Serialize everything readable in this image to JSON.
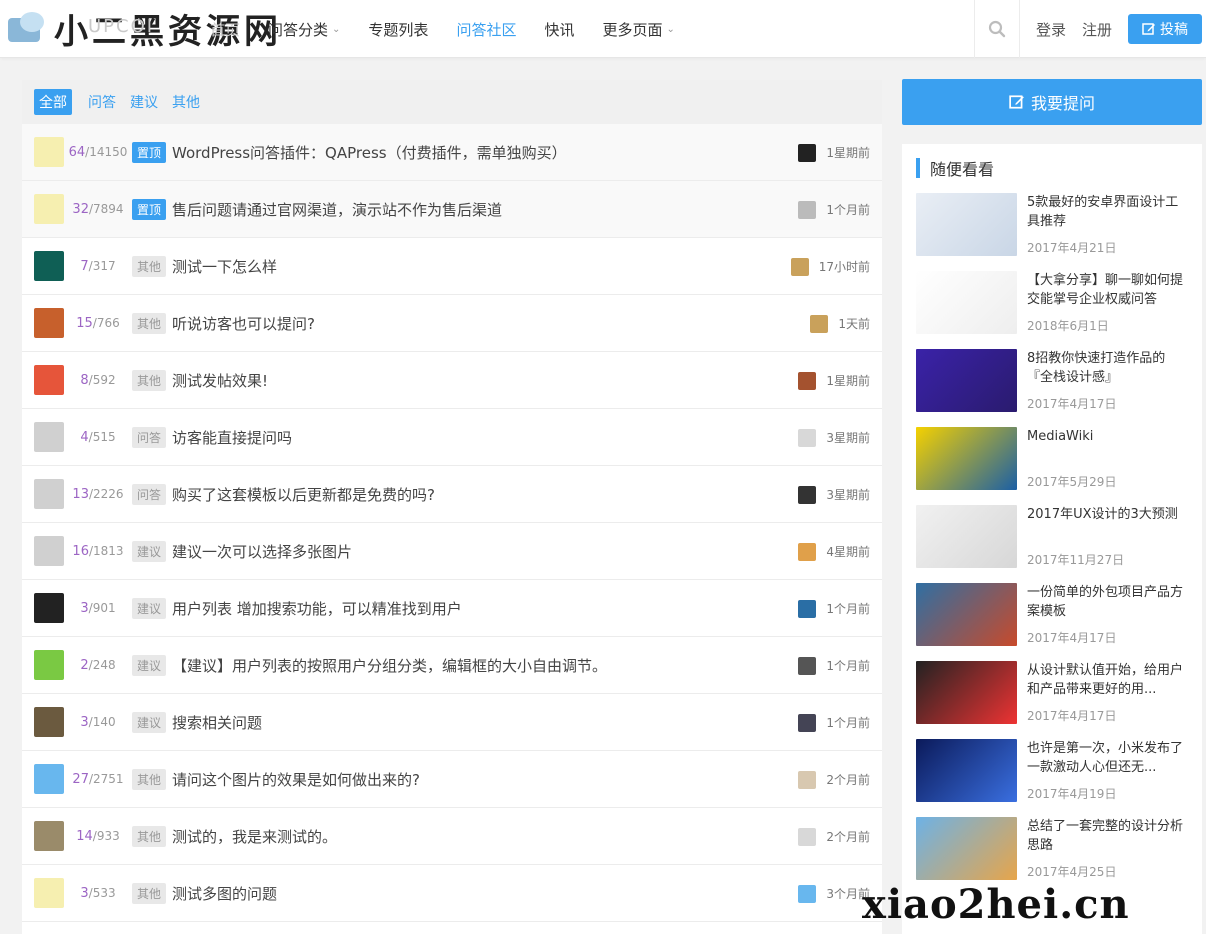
{
  "header": {
    "logo_text": "小二黑资源网",
    "logo_ghost": "UPCOI",
    "nav": [
      {
        "label": "首页",
        "dropdown": false
      },
      {
        "label": "问答分类",
        "dropdown": true
      },
      {
        "label": "专题列表",
        "dropdown": false
      },
      {
        "label": "问答社区",
        "dropdown": false,
        "active": true
      },
      {
        "label": "快讯",
        "dropdown": false
      },
      {
        "label": "更多页面",
        "dropdown": true
      }
    ],
    "login": "登录",
    "register": "注册",
    "submit": "投稿"
  },
  "filters": [
    "全部",
    "问答",
    "建议",
    "其他"
  ],
  "questions": [
    {
      "answers": "64",
      "views": "14150",
      "tag": "置顶",
      "sticky": true,
      "title": "WordPress问答插件：QAPress（付费插件，需单独购买）",
      "time": "1星期前"
    },
    {
      "answers": "32",
      "views": "7894",
      "tag": "置顶",
      "sticky": true,
      "title": "售后问题请通过官网渠道，演示站不作为售后渠道",
      "time": "1个月前"
    },
    {
      "answers": "7",
      "views": "317",
      "tag": "其他",
      "title": "测试一下怎么样",
      "time": "17小时前"
    },
    {
      "answers": "15",
      "views": "766",
      "tag": "其他",
      "title": "听说访客也可以提问?",
      "time": "1天前"
    },
    {
      "answers": "8",
      "views": "592",
      "tag": "其他",
      "title": "测试发帖效果!",
      "time": "1星期前"
    },
    {
      "answers": "4",
      "views": "515",
      "tag": "问答",
      "title": "访客能直接提问吗",
      "time": "3星期前"
    },
    {
      "answers": "13",
      "views": "2226",
      "tag": "问答",
      "title": "购买了这套模板以后更新都是免费的吗?",
      "time": "3星期前"
    },
    {
      "answers": "16",
      "views": "1813",
      "tag": "建议",
      "title": "建议一次可以选择多张图片",
      "time": "4星期前"
    },
    {
      "answers": "3",
      "views": "901",
      "tag": "建议",
      "title": "用户列表 增加搜索功能，可以精准找到用户",
      "time": "1个月前"
    },
    {
      "answers": "2",
      "views": "248",
      "tag": "建议",
      "title": "【建议】用户列表的按照用户分组分类，编辑框的大小自由调节。",
      "time": "1个月前"
    },
    {
      "answers": "3",
      "views": "140",
      "tag": "建议",
      "title": "搜索相关问题",
      "time": "1个月前"
    },
    {
      "answers": "27",
      "views": "2751",
      "tag": "其他",
      "title": "请问这个图片的效果是如何做出来的?",
      "time": "2个月前"
    },
    {
      "answers": "14",
      "views": "933",
      "tag": "其他",
      "title": "测试的，我是来测试的。",
      "time": "2个月前"
    },
    {
      "answers": "3",
      "views": "533",
      "tag": "其他",
      "title": "测试多图的问题",
      "time": "3个月前"
    }
  ],
  "sidebar": {
    "ask_button": "我要提问",
    "widget_title": "随便看看",
    "posts": [
      {
        "title": "5款最好的安卓界面设计工具推荐",
        "date": "2017年4月21日"
      },
      {
        "title": "【大拿分享】聊一聊如何提交能掌号企业权威问答",
        "date": "2018年6月1日"
      },
      {
        "title": "8招教你快速打造作品的『全栈设计感』",
        "date": "2017年4月17日"
      },
      {
        "title": "MediaWiki",
        "date": "2017年5月29日"
      },
      {
        "title": "2017年UX设计的3大预测",
        "date": "2017年11月27日"
      },
      {
        "title": "一份简单的外包项目产品方案模板",
        "date": "2017年4月17日"
      },
      {
        "title": "从设计默认值开始，给用户和产品带来更好的用...",
        "date": "2017年4月17日"
      },
      {
        "title": "也许是第一次，小米发布了一款激动人心但还无...",
        "date": "2017年4月19日"
      },
      {
        "title": "总结了一套完整的设计分析思路",
        "date": "2017年4月25日"
      }
    ]
  },
  "watermark": "xiao2hei.cn",
  "colors": {
    "accent": "#3aa0f0",
    "answer_count": "#9c65c4"
  }
}
